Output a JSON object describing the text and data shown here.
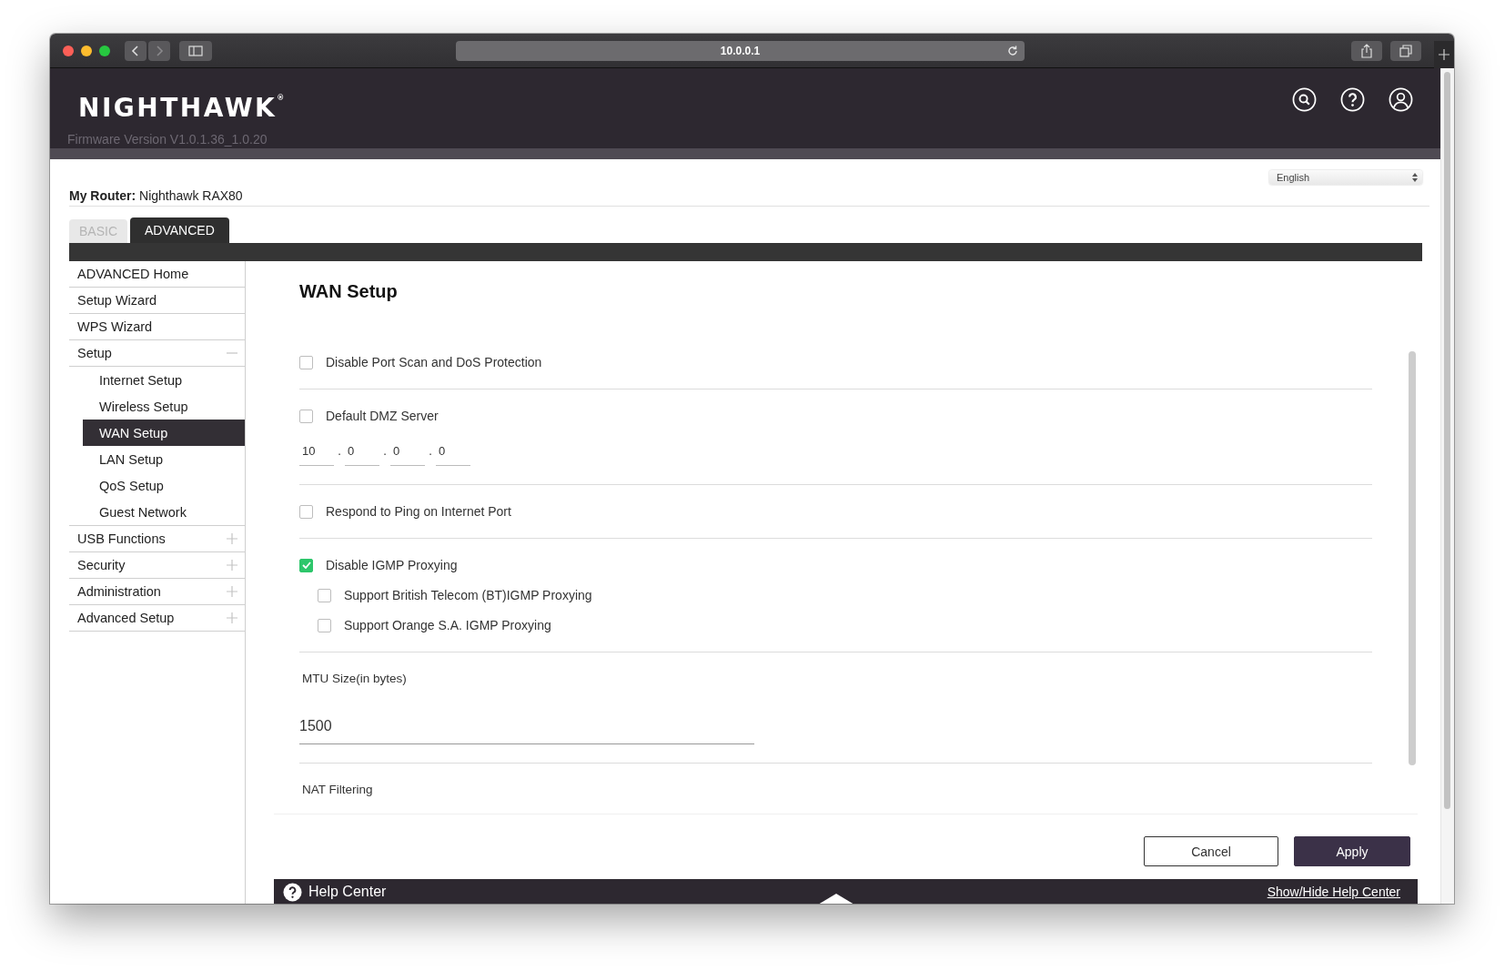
{
  "browser": {
    "url": "10.0.0.1"
  },
  "header": {
    "logo": "NIGHTHAWK$^{®}$",
    "firmware": "Firmware Version V1.0.1.36_1.0.20"
  },
  "router": "**My Router:** Nighthawk RAX80",
  "language": {
    "value": "English"
  },
  "tabs": [
    {
      "label": "BASIC",
      "selected": false
    },
    {
      "label": "ADVANCED",
      "selected": true
    }
  ],
  "sidebar": {
    "items": [
      {
        "label": "ADVANCED Home",
        "selected": false
      },
      {
        "label": "Setup Wizard",
        "selected": false
      },
      {
        "label": "WPS Wizard",
        "selected": false
      },
      {
        "label": "Setup",
        "selected": false,
        "expanded": true,
        "children": [
          {
            "label": "Internet Setup",
            "selected": false
          },
          {
            "label": "Wireless Setup",
            "selected": false
          },
          {
            "label": "WAN Setup",
            "selected": true
          },
          {
            "label": "LAN Setup",
            "selected": false
          },
          {
            "label": "QoS Setup",
            "selected": false
          },
          {
            "label": "Guest Network",
            "selected": false
          }
        ]
      },
      {
        "label": "USB Functions",
        "selected": false,
        "expanded": false
      },
      {
        "label": "Security",
        "selected": false,
        "expanded": false
      },
      {
        "label": "Administration",
        "selected": false,
        "expanded": false
      },
      {
        "label": "Advanced Setup",
        "selected": false,
        "expanded": false
      }
    ]
  },
  "form": {
    "title": "WAN Setup",
    "sections": [
      {
        "items": [
          {
            "kind": "checkbox",
            "label": "Disable Port Scan and DoS Protection",
            "checked": false
          }
        ]
      },
      {
        "items": [
          {
            "kind": "checkbox",
            "label": "Default DMZ Server",
            "checked": false
          },
          {
            "kind": "ip",
            "separator": ".",
            "octets": [
              "10",
              "0",
              "0",
              "0"
            ]
          }
        ]
      },
      {
        "items": [
          {
            "kind": "checkbox",
            "label": "Respond to Ping on Internet Port",
            "checked": false
          }
        ]
      },
      {
        "items": [
          {
            "kind": "checkbox",
            "label": "Disable IGMP Proxying",
            "checked": true,
            "children": [
              {
                "kind": "checkbox",
                "label": "Support British Telecom (BT)IGMP Proxying",
                "checked": false
              },
              {
                "kind": "checkbox",
                "label": "Support Orange S.A. IGMP Proxying",
                "checked": false
              }
            ]
          }
        ]
      },
      {
        "items": [
          {
            "kind": "field",
            "label": "MTU Size(in bytes)",
            "value": "1500"
          }
        ]
      },
      {
        "items": [
          {
            "kind": "label",
            "label": "NAT Filtering"
          }
        ]
      }
    ]
  },
  "buttons": [
    {
      "label": "Cancel",
      "kind": "secondary"
    },
    {
      "label": "Apply",
      "kind": "primary"
    }
  ],
  "help_bar": {
    "title": "Help Center",
    "link": "Show/Hide Help Center"
  }
}
